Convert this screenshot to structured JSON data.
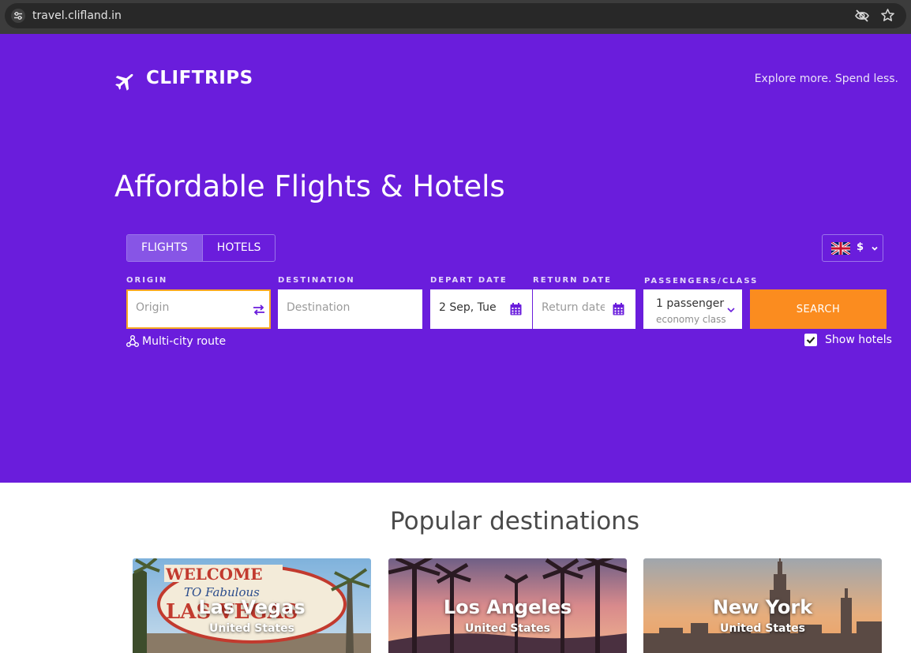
{
  "browser": {
    "url": "travel.clifland.in"
  },
  "header": {
    "brand": "CLIFTRIPS",
    "tagline": "Explore more. Spend less."
  },
  "hero": {
    "headline": "Affordable Flights & Hotels"
  },
  "tabs": [
    {
      "label": "FLIGHTS",
      "active": true
    },
    {
      "label": "HOTELS",
      "active": false
    }
  ],
  "locale": {
    "currency": "$",
    "flag": "uk-flag-icon"
  },
  "form": {
    "origin": {
      "label": "ORIGIN",
      "placeholder": "Origin",
      "value": ""
    },
    "destination": {
      "label": "DESTINATION",
      "placeholder": "Destination",
      "value": ""
    },
    "depart": {
      "label": "DEPART DATE",
      "value": "2 Sep, Tue"
    },
    "return": {
      "label": "RETURN DATE",
      "placeholder": "Return date",
      "value": ""
    },
    "passengers": {
      "label": "PASSENGERS/CLASS",
      "count": "1 passenger",
      "class": "economy class"
    },
    "search_label": "SEARCH",
    "multicity_label": "Multi-city route",
    "show_hotels_label": "Show hotels",
    "show_hotels_checked": true
  },
  "popular": {
    "title": "Popular destinations",
    "cards": [
      {
        "city": "Las Vegas",
        "country": "United States"
      },
      {
        "city": "Los Angeles",
        "country": "United States"
      },
      {
        "city": "New York",
        "country": "United States"
      }
    ]
  },
  "colors": {
    "hero_bg": "#6a1ddc",
    "search_button": "#fb8c1f",
    "origin_border": "#f7a823",
    "icon_purple": "#6a1ddc"
  }
}
